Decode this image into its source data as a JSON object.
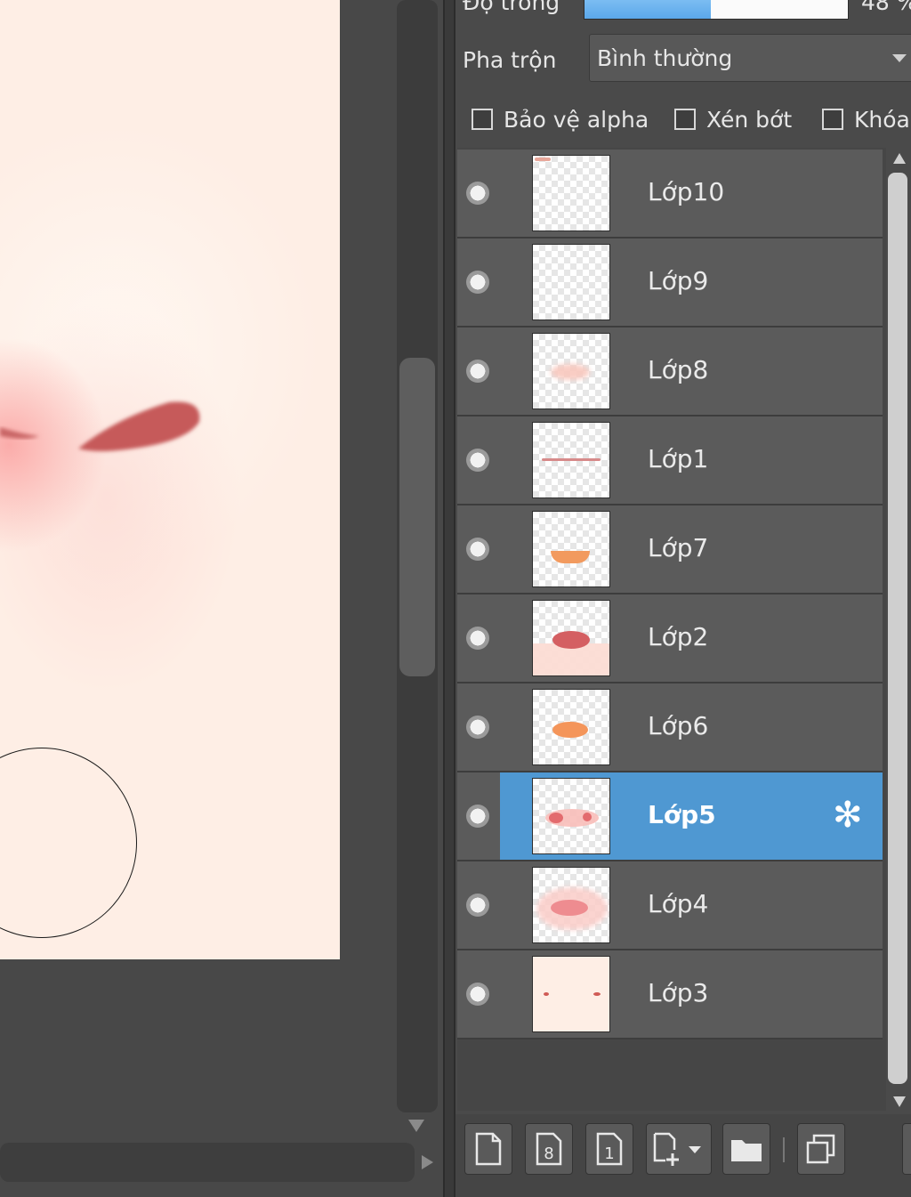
{
  "layer_panel": {
    "opacity": {
      "label": "Độ trong",
      "value_text": "48 %",
      "fraction": 0.48
    },
    "blend": {
      "label": "Pha trộn",
      "value": "Bình thường"
    },
    "checkboxes": [
      {
        "label": "Bảo vệ alpha",
        "checked": false
      },
      {
        "label": "Xén bớt",
        "checked": false
      },
      {
        "label": "Khóa",
        "checked": false
      }
    ],
    "layers": [
      {
        "name": "Lớp10",
        "selected": false
      },
      {
        "name": "Lớp9",
        "selected": false
      },
      {
        "name": "Lớp8",
        "selected": false
      },
      {
        "name": "Lớp1",
        "selected": false
      },
      {
        "name": "Lớp7",
        "selected": false
      },
      {
        "name": "Lớp2",
        "selected": false
      },
      {
        "name": "Lớp6",
        "selected": false
      },
      {
        "name": "Lớp5",
        "selected": true
      },
      {
        "name": "Lớp4",
        "selected": false
      },
      {
        "name": "Lớp3",
        "selected": false
      }
    ],
    "toolbar_icons": [
      "new-layer-icon",
      "new-8bit-layer-icon",
      "new-1bit-layer-icon",
      "add-layer-dropdown-icon",
      "new-folder-icon",
      "duplicate-layer-icon"
    ]
  },
  "colors": {
    "selection": "#4f98d2",
    "canvas_background": "#feeee5",
    "panel_background": "#4a4a4a"
  }
}
